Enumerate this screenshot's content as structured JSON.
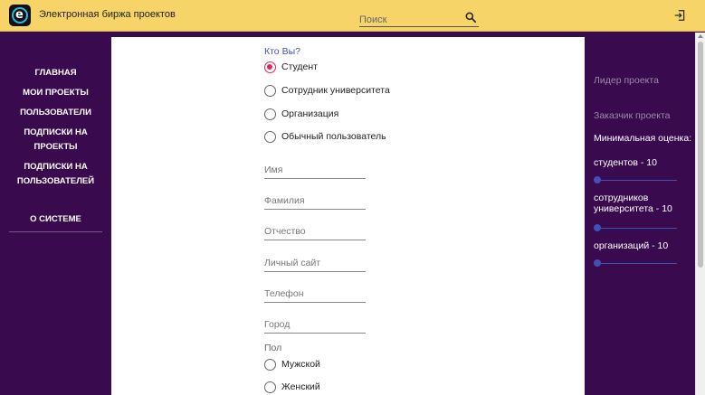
{
  "header": {
    "title": "Электронная биржа проектов",
    "search_placeholder": "Поиск",
    "search_icon": "search-icon",
    "logout_icon": "logout-icon"
  },
  "sidebar": {
    "items": [
      {
        "label": "ГЛАВНАЯ"
      },
      {
        "label": "МОИ ПРОЕКТЫ"
      },
      {
        "label": "ПОЛЬЗОВАТЕЛИ"
      },
      {
        "label": "ПОДПИСКИ НА ПРОЕКТЫ"
      },
      {
        "label": "ПОДПИСКИ НА ПОЛЬЗОВАТЕЛЕЙ"
      },
      {
        "label": "О СИСТЕМЕ"
      }
    ]
  },
  "form": {
    "who_label": "Кто Вы?",
    "roles": [
      {
        "label": "Студент",
        "checked": true
      },
      {
        "label": "Сотрудник университета",
        "checked": false
      },
      {
        "label": "Организация",
        "checked": false
      },
      {
        "label": "Обычный пользователь",
        "checked": false
      }
    ],
    "fields": [
      {
        "placeholder": "Имя"
      },
      {
        "placeholder": "Фамилия"
      },
      {
        "placeholder": "Отчество"
      },
      {
        "placeholder": "Личный сайт"
      },
      {
        "placeholder": "Телефон"
      },
      {
        "placeholder": "Город"
      }
    ],
    "sex_label": "Пол",
    "sexes": [
      {
        "label": "Мужской",
        "checked": false
      },
      {
        "label": "Женский",
        "checked": false
      }
    ]
  },
  "right_panel": {
    "leader_placeholder": "Лидер проекта",
    "customer_placeholder": "Заказчик проекта",
    "min_rating_label": "Минимальная оценка:",
    "sliders": [
      {
        "label": "студентов - 10",
        "value": 10
      },
      {
        "label": "сотрудников университета - 10",
        "value": 10
      },
      {
        "label": "организаций - 10",
        "value": 10
      }
    ]
  },
  "colors": {
    "header_bg": "#f7d468",
    "sidebar_bg": "#3a0a4f",
    "accent": "#3f51b5",
    "radio_checked": "#e0245e"
  }
}
